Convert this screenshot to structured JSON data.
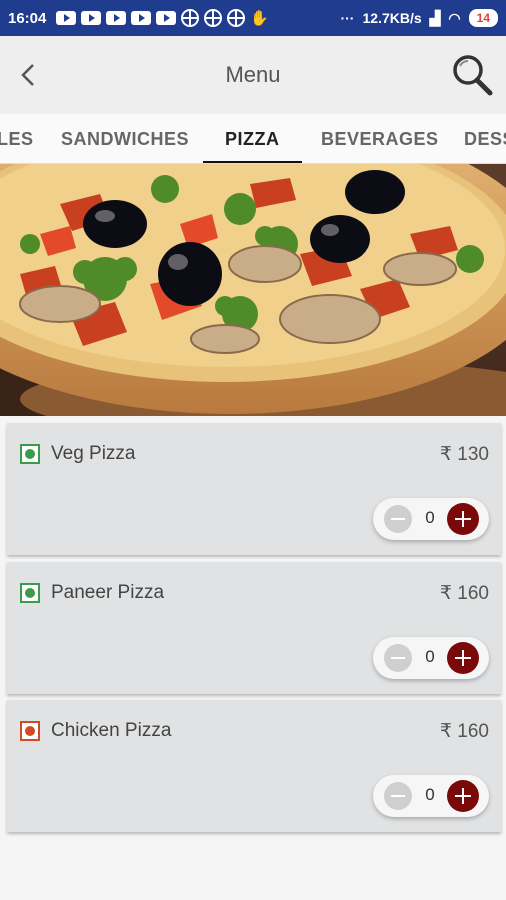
{
  "status_bar": {
    "time": "16:04",
    "network_speed": "12.7KB/s",
    "battery": "14"
  },
  "app_bar": {
    "title": "Menu"
  },
  "tabs": [
    {
      "label": "LES"
    },
    {
      "label": "SANDWICHES"
    },
    {
      "label": "PIZZA",
      "active": true
    },
    {
      "label": "BEVERAGES"
    },
    {
      "label": "DESS"
    }
  ],
  "items": [
    {
      "name": "Veg Pizza",
      "price": "₹ 130",
      "qty": "0",
      "type": "veg"
    },
    {
      "name": "Paneer Pizza",
      "price": "₹ 160",
      "qty": "0",
      "type": "veg"
    },
    {
      "name": "Chicken Pizza",
      "price": "₹ 160",
      "qty": "0",
      "type": "non-veg"
    }
  ],
  "colors": {
    "status_bar": "#1f3c8f",
    "accent": "#7a0a0a",
    "veg": "#3a9b4a",
    "non_veg": "#d04a24",
    "card": "#e1e2e3"
  }
}
